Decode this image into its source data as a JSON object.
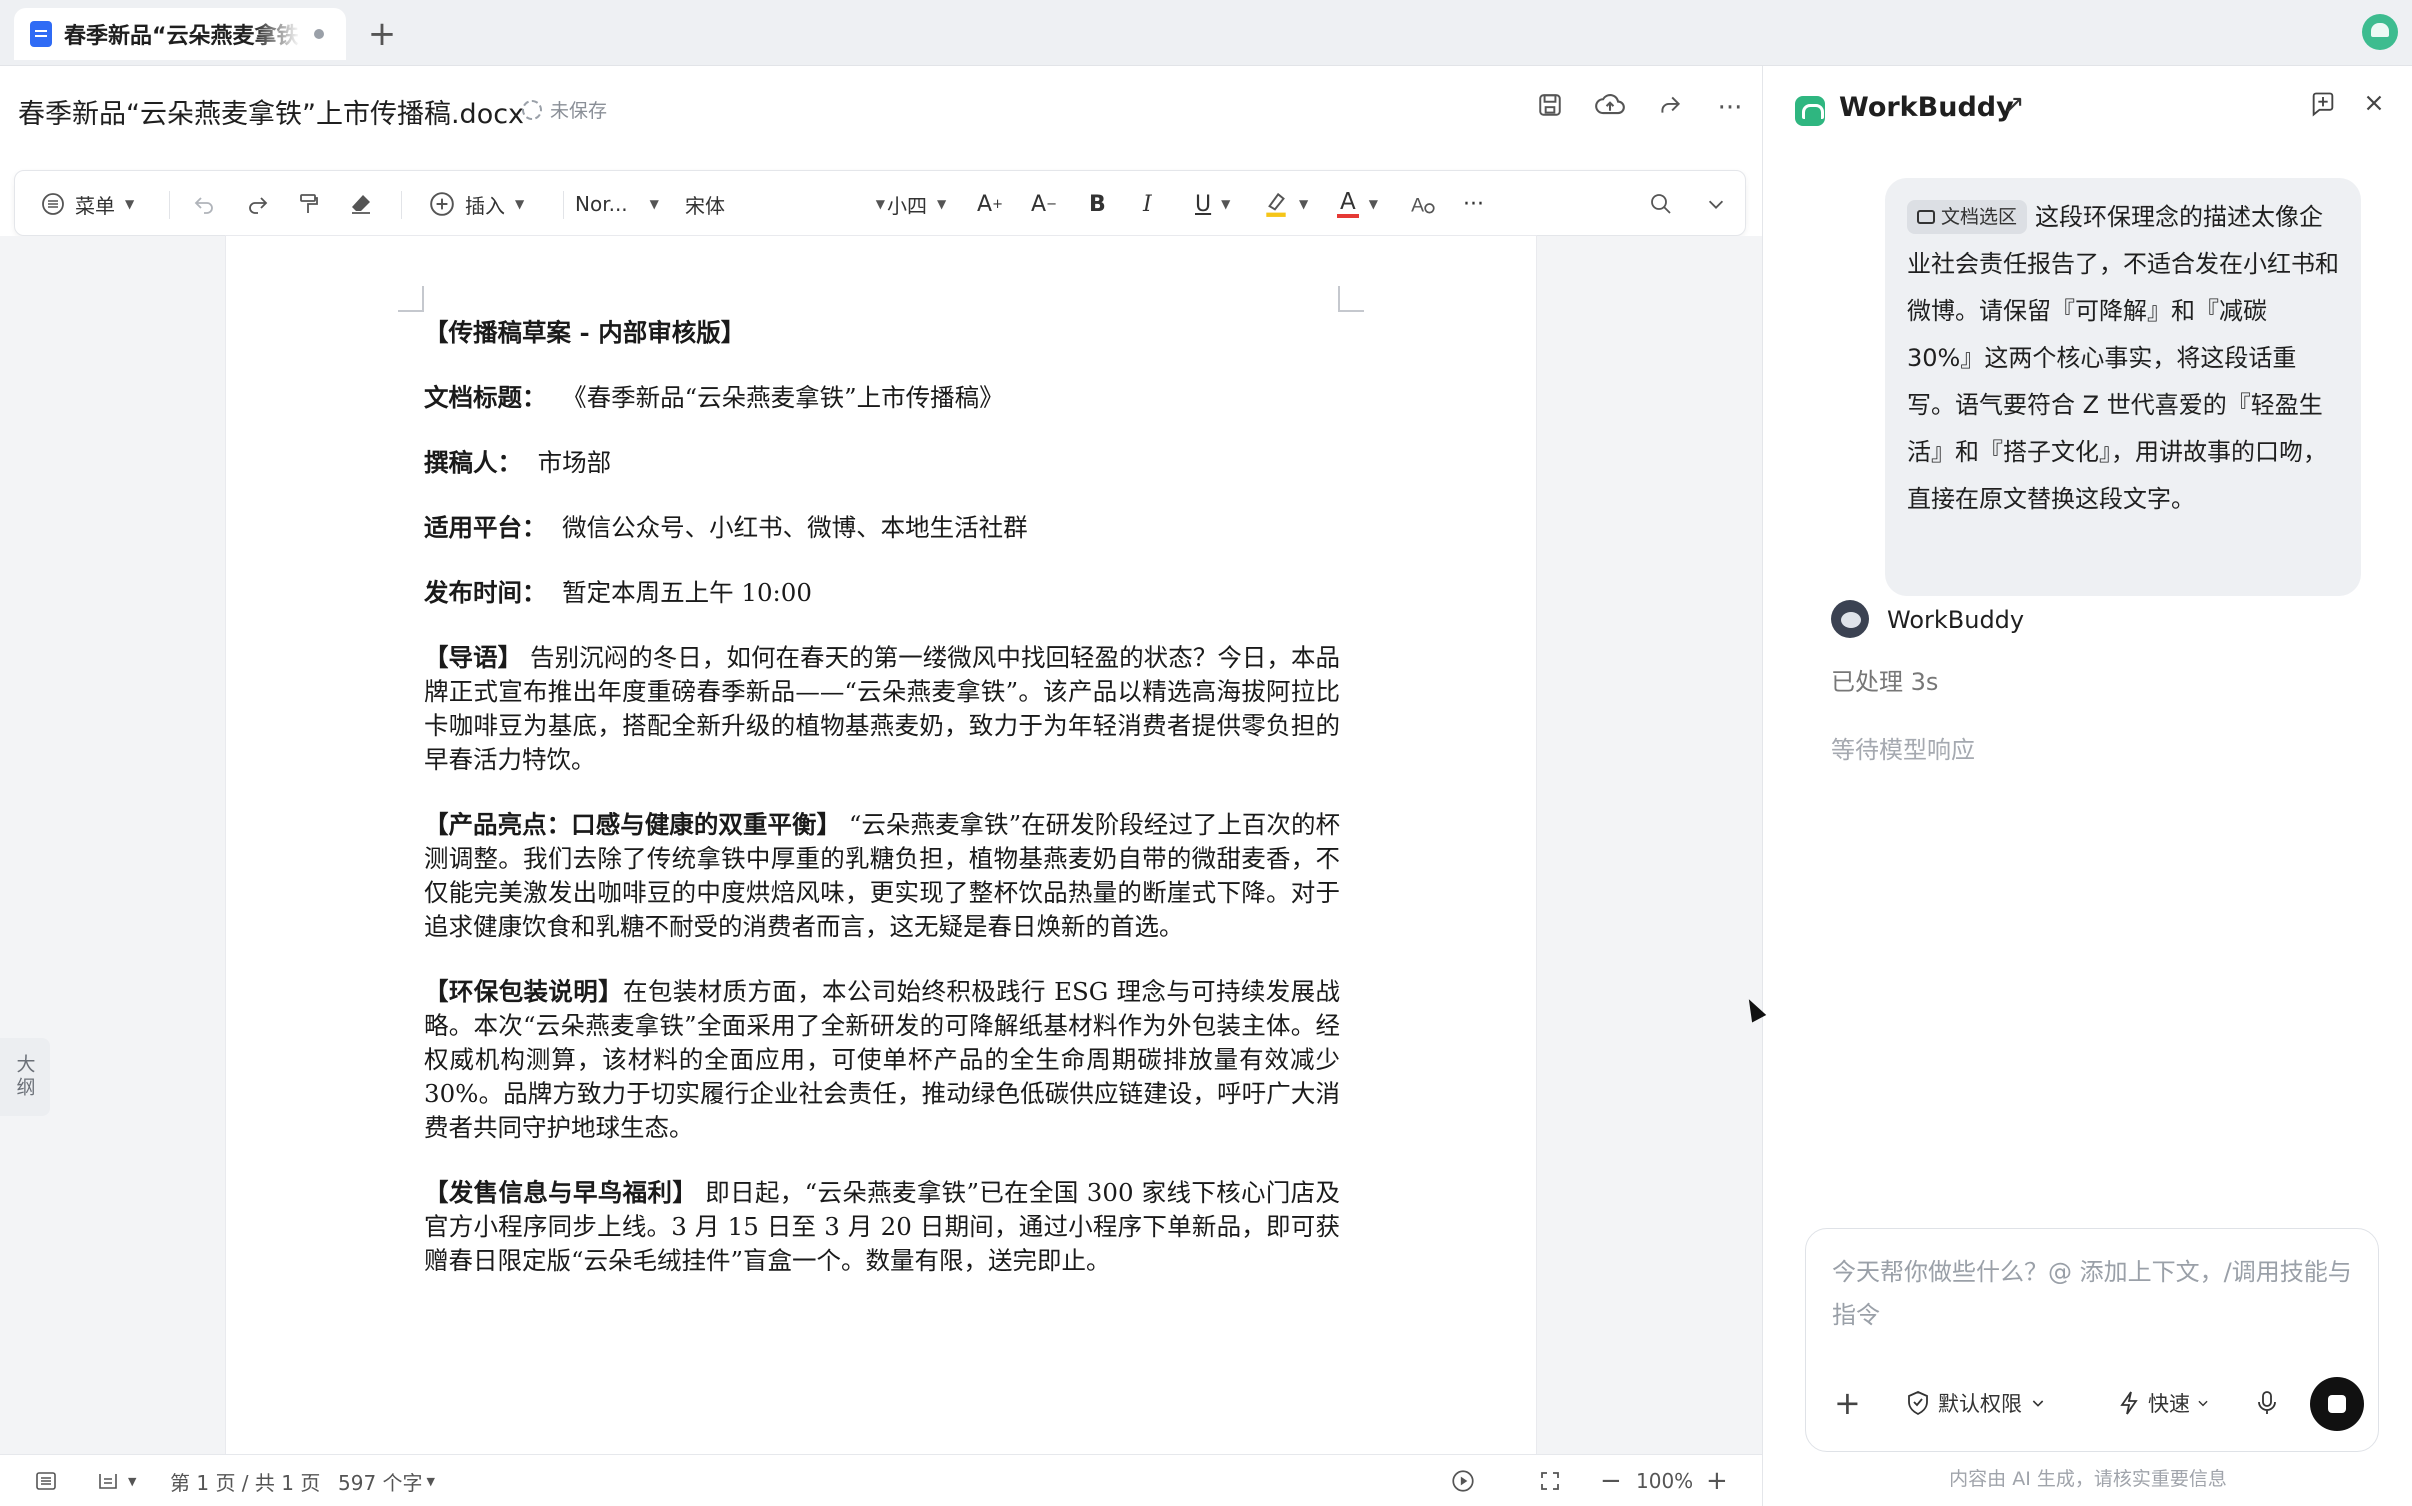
{
  "tabbar": {
    "tab_title": "春季新品“云朵燕麦拿铁”上市传播稿.docx",
    "new_tab": "+"
  },
  "header": {
    "doc_title": "春季新品“云朵燕麦拿铁”上市传播稿.docx",
    "save_state": "未保存"
  },
  "toolbar": {
    "menu": "菜单",
    "insert": "插入",
    "style": "Nor...",
    "font": "宋体",
    "size": "小四",
    "bold": "B",
    "italic": "I",
    "underline": "U",
    "font_color": "A",
    "more": "···"
  },
  "document": {
    "p1": "【传播稿草案 - 内部审核版】",
    "p2_label": "文档标题：",
    "p2_value": "《春季新品“云朵燕麦拿铁”上市传播稿》",
    "p3_label": "撰稿人：",
    "p3_value": "市场部",
    "p4_label": "适用平台：",
    "p4_value": "微信公众号、小红书、微博、本地生活社群",
    "p5_label": "发布时间：",
    "p5_value": "暂定本周五上午 10:00",
    "p6_label": "【导语】",
    "p6_text": "告别沉闷的冬日，如何在春天的第一缕微风中找回轻盈的状态？今日，本品牌正式宣布推出年度重磅春季新品——“云朵燕麦拿铁”。该产品以精选高海拔阿拉比卡咖啡豆为基底，搭配全新升级的植物基燕麦奶，致力于为年轻消费者提供零负担的早春活力特饮。",
    "p7_label": "【产品亮点：口感与健康的双重平衡】",
    "p7_text": "“云朵燕麦拿铁”在研发阶段经过了上百次的杯测调整。我们去除了传统拿铁中厚重的乳糖负担，植物基燕麦奶自带的微甜麦香，不仅能完美激发出咖啡豆的中度烘焙风味，更实现了整杯饮品热量的断崖式下降。对于追求健康饮食和乳糖不耐受的消费者而言，这无疑是春日焕新的首选。",
    "p8_label": "【环保包装说明】",
    "p8_text": "在包装材质方面，本公司始终积极践行 ESG 理念与可持续发展战略。本次“云朵燕麦拿铁”全面采用了全新研发的可降解纸基材料作为外包装主体。经权威机构测算，该材料的全面应用，可使单杯产品的全生命周期碳排放量有效减少 30%。品牌方致力于切实履行企业社会责任，推动绿色低碳供应链建设，呼吁广大消费者共同守护地球生态。",
    "p9_label": "【发售信息与早鸟福利】",
    "p9_text": "即日起，“云朵燕麦拿铁”已在全国 300 家线下核心门店及官方小程序同步上线。3 月 15 日至 3 月 20 日期间，通过小程序下单新品，即可获赠春日限定版“云朵毛绒挂件”盲盒一个。数量有限，送完即止。"
  },
  "outline_tab": "大纲",
  "statusbar": {
    "page": "第 1 页 / 共 1 页",
    "words": "597 个字",
    "zoom": "100%"
  },
  "panel": {
    "title": "WorkBuddy",
    "user_chip": "文档选区",
    "user_message": "这段环保理念的描述太像企业社会责任报告了，不适合发在小红书和微博。请保留『可降解』和『减碳 30%』这两个核心事实，将这段话重写。语气要符合 Z 世代喜爱的『轻盈生活』和『搭子文化』，用讲故事的口吻，直接在原文替换这段文字。",
    "bot_name": "WorkBuddy",
    "processed": "已处理 3s",
    "waiting": "等待模型响应",
    "composer_placeholder": "今天帮你做些什么？@ 添加上下文，/调用技能与指令",
    "permission": "默认权限",
    "speed": "快速",
    "disclaimer": "内容由 AI 生成，请核实重要信息"
  }
}
